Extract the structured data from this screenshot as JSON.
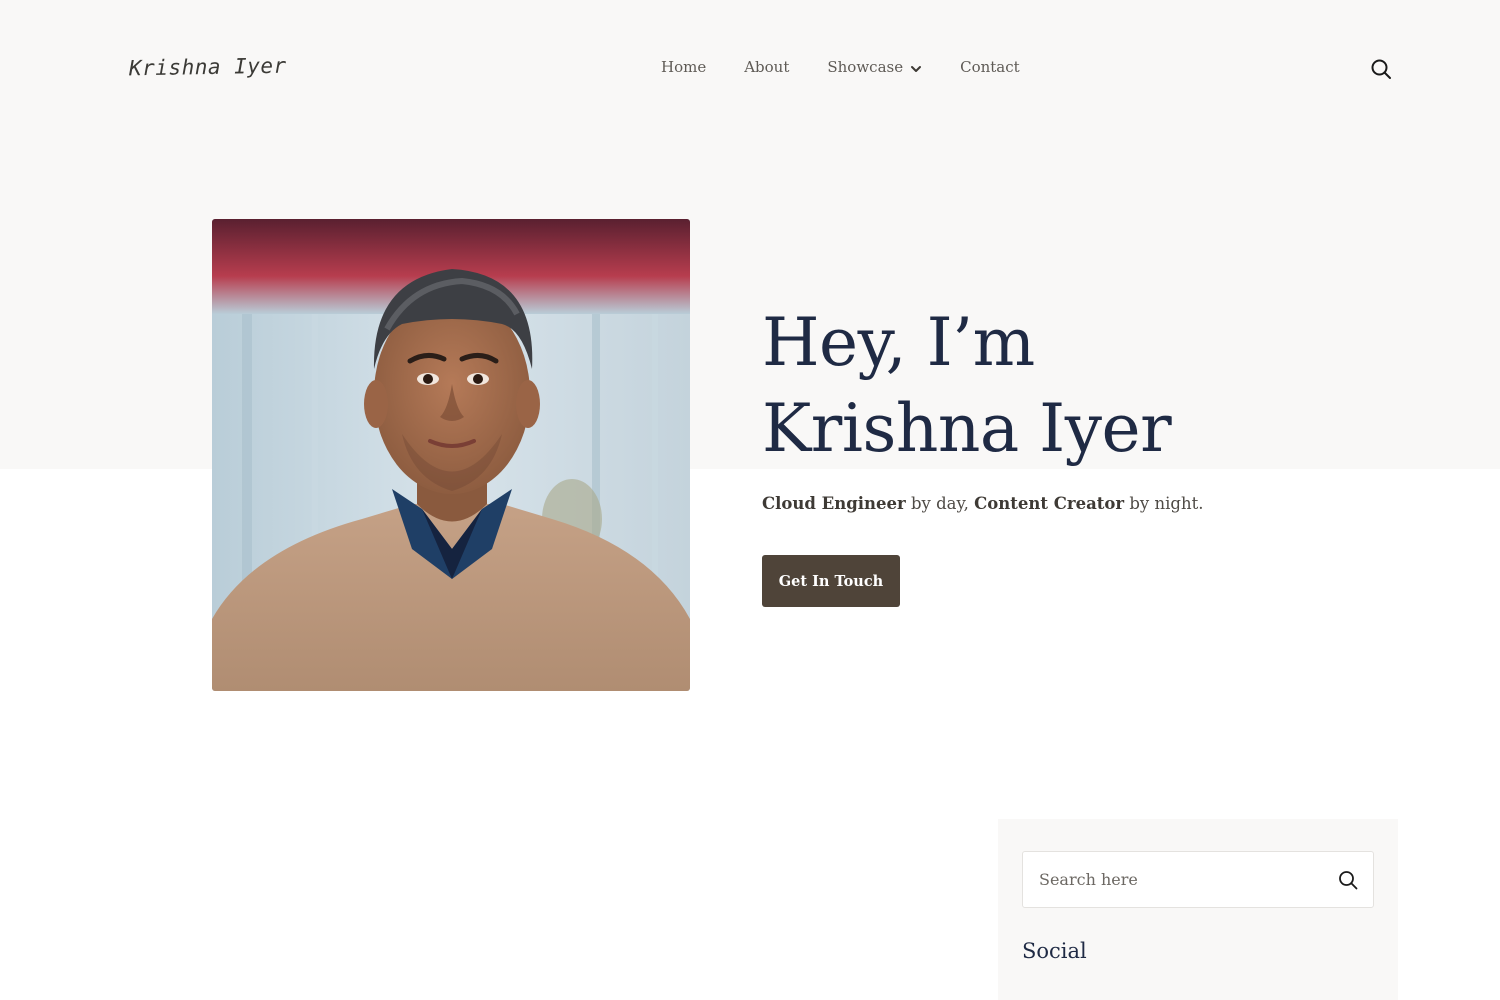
{
  "header": {
    "logo_text": "Krishna Iyer",
    "nav": [
      {
        "label": "Home"
      },
      {
        "label": "About"
      },
      {
        "label": "Showcase",
        "has_dropdown": true
      },
      {
        "label": "Contact"
      }
    ],
    "search_icon": "search-icon"
  },
  "hero": {
    "title_line1": "Hey, I’m",
    "title_line2": "Krishna Iyer",
    "tagline": {
      "role1": "Cloud Engineer",
      "mid1": " by day, ",
      "role2": "Content Creator",
      "mid2": " by night."
    },
    "cta_label": "Get In Touch",
    "photo": "portrait-photo"
  },
  "sidebar": {
    "search_placeholder": "Search here",
    "heading": "Social"
  },
  "colors": {
    "hero_bg": "#f9f8f7",
    "heading": "#1f2a44",
    "cta_bg": "#4f4439",
    "text": "#4f4b46"
  }
}
